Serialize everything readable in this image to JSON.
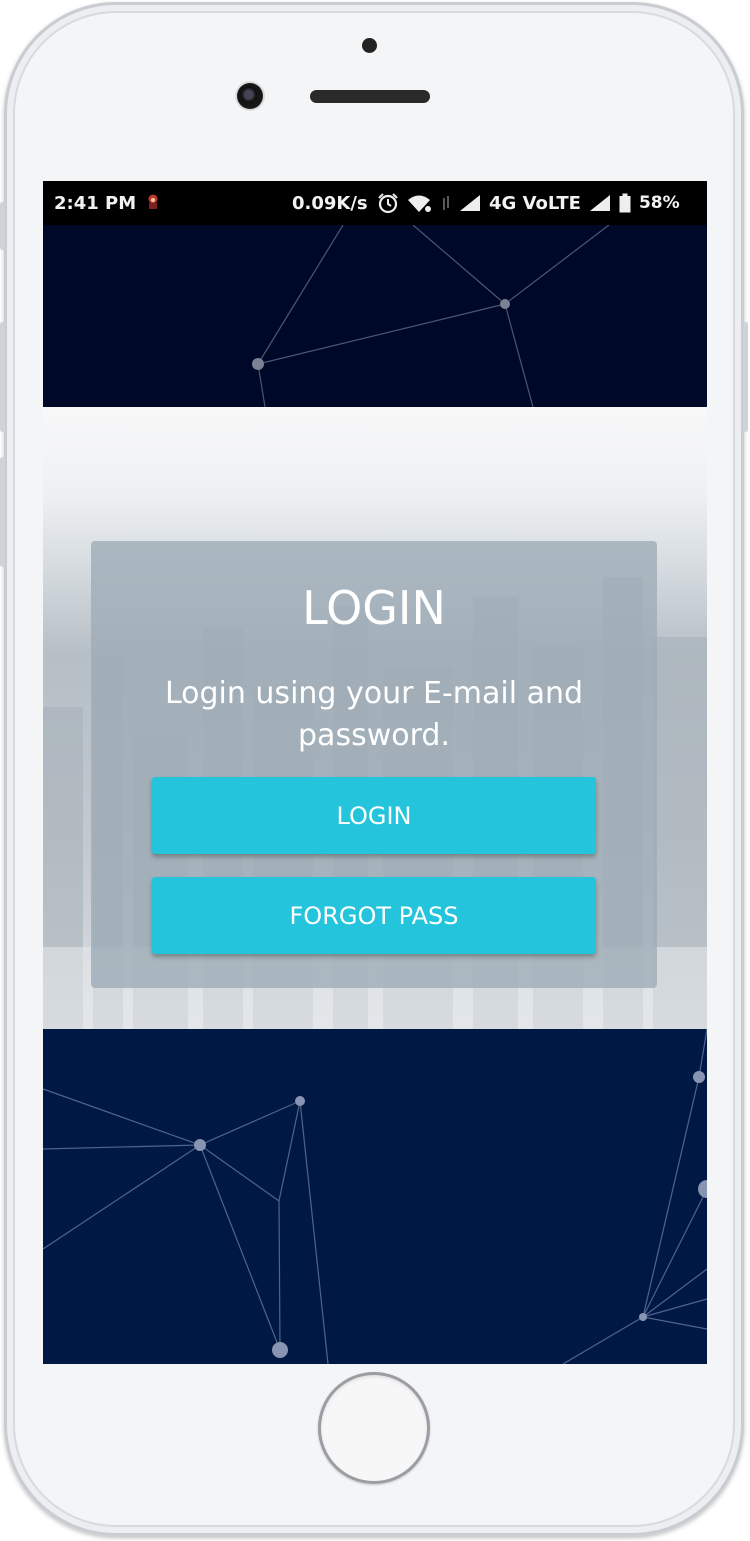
{
  "status_bar": {
    "time": "2:41 PM",
    "speed": "0.09K/s",
    "network": "4G VoLTE",
    "battery": "58%"
  },
  "login_card": {
    "title": "LOGIN",
    "subtitle": "Login using your E-mail and password.",
    "login_button": "LOGIN",
    "forgot_button": "FORGOT PASS",
    "accent_color": "#24c4dc"
  },
  "colors": {
    "top_band": "#000829",
    "bottom_band": "#001944",
    "card_overlay": "#9eacb6"
  },
  "icons": [
    "alarm-icon",
    "wifi-icon",
    "signal-icon",
    "battery-icon",
    "notification-avatar-icon"
  ]
}
